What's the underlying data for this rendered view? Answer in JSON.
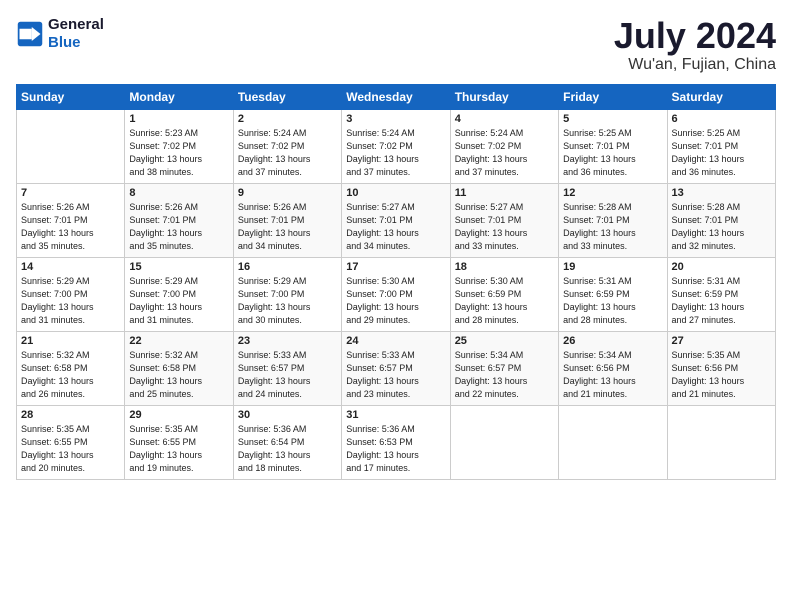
{
  "header": {
    "logo_line1": "General",
    "logo_line2": "Blue",
    "title": "July 2024",
    "location": "Wu'an, Fujian, China"
  },
  "days_of_week": [
    "Sunday",
    "Monday",
    "Tuesday",
    "Wednesday",
    "Thursday",
    "Friday",
    "Saturday"
  ],
  "weeks": [
    [
      {
        "day": "",
        "text": ""
      },
      {
        "day": "1",
        "text": "Sunrise: 5:23 AM\nSunset: 7:02 PM\nDaylight: 13 hours\nand 38 minutes."
      },
      {
        "day": "2",
        "text": "Sunrise: 5:24 AM\nSunset: 7:02 PM\nDaylight: 13 hours\nand 37 minutes."
      },
      {
        "day": "3",
        "text": "Sunrise: 5:24 AM\nSunset: 7:02 PM\nDaylight: 13 hours\nand 37 minutes."
      },
      {
        "day": "4",
        "text": "Sunrise: 5:24 AM\nSunset: 7:02 PM\nDaylight: 13 hours\nand 37 minutes."
      },
      {
        "day": "5",
        "text": "Sunrise: 5:25 AM\nSunset: 7:01 PM\nDaylight: 13 hours\nand 36 minutes."
      },
      {
        "day": "6",
        "text": "Sunrise: 5:25 AM\nSunset: 7:01 PM\nDaylight: 13 hours\nand 36 minutes."
      }
    ],
    [
      {
        "day": "7",
        "text": "Sunrise: 5:26 AM\nSunset: 7:01 PM\nDaylight: 13 hours\nand 35 minutes."
      },
      {
        "day": "8",
        "text": "Sunrise: 5:26 AM\nSunset: 7:01 PM\nDaylight: 13 hours\nand 35 minutes."
      },
      {
        "day": "9",
        "text": "Sunrise: 5:26 AM\nSunset: 7:01 PM\nDaylight: 13 hours\nand 34 minutes."
      },
      {
        "day": "10",
        "text": "Sunrise: 5:27 AM\nSunset: 7:01 PM\nDaylight: 13 hours\nand 34 minutes."
      },
      {
        "day": "11",
        "text": "Sunrise: 5:27 AM\nSunset: 7:01 PM\nDaylight: 13 hours\nand 33 minutes."
      },
      {
        "day": "12",
        "text": "Sunrise: 5:28 AM\nSunset: 7:01 PM\nDaylight: 13 hours\nand 33 minutes."
      },
      {
        "day": "13",
        "text": "Sunrise: 5:28 AM\nSunset: 7:01 PM\nDaylight: 13 hours\nand 32 minutes."
      }
    ],
    [
      {
        "day": "14",
        "text": "Sunrise: 5:29 AM\nSunset: 7:00 PM\nDaylight: 13 hours\nand 31 minutes."
      },
      {
        "day": "15",
        "text": "Sunrise: 5:29 AM\nSunset: 7:00 PM\nDaylight: 13 hours\nand 31 minutes."
      },
      {
        "day": "16",
        "text": "Sunrise: 5:29 AM\nSunset: 7:00 PM\nDaylight: 13 hours\nand 30 minutes."
      },
      {
        "day": "17",
        "text": "Sunrise: 5:30 AM\nSunset: 7:00 PM\nDaylight: 13 hours\nand 29 minutes."
      },
      {
        "day": "18",
        "text": "Sunrise: 5:30 AM\nSunset: 6:59 PM\nDaylight: 13 hours\nand 28 minutes."
      },
      {
        "day": "19",
        "text": "Sunrise: 5:31 AM\nSunset: 6:59 PM\nDaylight: 13 hours\nand 28 minutes."
      },
      {
        "day": "20",
        "text": "Sunrise: 5:31 AM\nSunset: 6:59 PM\nDaylight: 13 hours\nand 27 minutes."
      }
    ],
    [
      {
        "day": "21",
        "text": "Sunrise: 5:32 AM\nSunset: 6:58 PM\nDaylight: 13 hours\nand 26 minutes."
      },
      {
        "day": "22",
        "text": "Sunrise: 5:32 AM\nSunset: 6:58 PM\nDaylight: 13 hours\nand 25 minutes."
      },
      {
        "day": "23",
        "text": "Sunrise: 5:33 AM\nSunset: 6:57 PM\nDaylight: 13 hours\nand 24 minutes."
      },
      {
        "day": "24",
        "text": "Sunrise: 5:33 AM\nSunset: 6:57 PM\nDaylight: 13 hours\nand 23 minutes."
      },
      {
        "day": "25",
        "text": "Sunrise: 5:34 AM\nSunset: 6:57 PM\nDaylight: 13 hours\nand 22 minutes."
      },
      {
        "day": "26",
        "text": "Sunrise: 5:34 AM\nSunset: 6:56 PM\nDaylight: 13 hours\nand 21 minutes."
      },
      {
        "day": "27",
        "text": "Sunrise: 5:35 AM\nSunset: 6:56 PM\nDaylight: 13 hours\nand 21 minutes."
      }
    ],
    [
      {
        "day": "28",
        "text": "Sunrise: 5:35 AM\nSunset: 6:55 PM\nDaylight: 13 hours\nand 20 minutes."
      },
      {
        "day": "29",
        "text": "Sunrise: 5:35 AM\nSunset: 6:55 PM\nDaylight: 13 hours\nand 19 minutes."
      },
      {
        "day": "30",
        "text": "Sunrise: 5:36 AM\nSunset: 6:54 PM\nDaylight: 13 hours\nand 18 minutes."
      },
      {
        "day": "31",
        "text": "Sunrise: 5:36 AM\nSunset: 6:53 PM\nDaylight: 13 hours\nand 17 minutes."
      },
      {
        "day": "",
        "text": ""
      },
      {
        "day": "",
        "text": ""
      },
      {
        "day": "",
        "text": ""
      }
    ]
  ]
}
